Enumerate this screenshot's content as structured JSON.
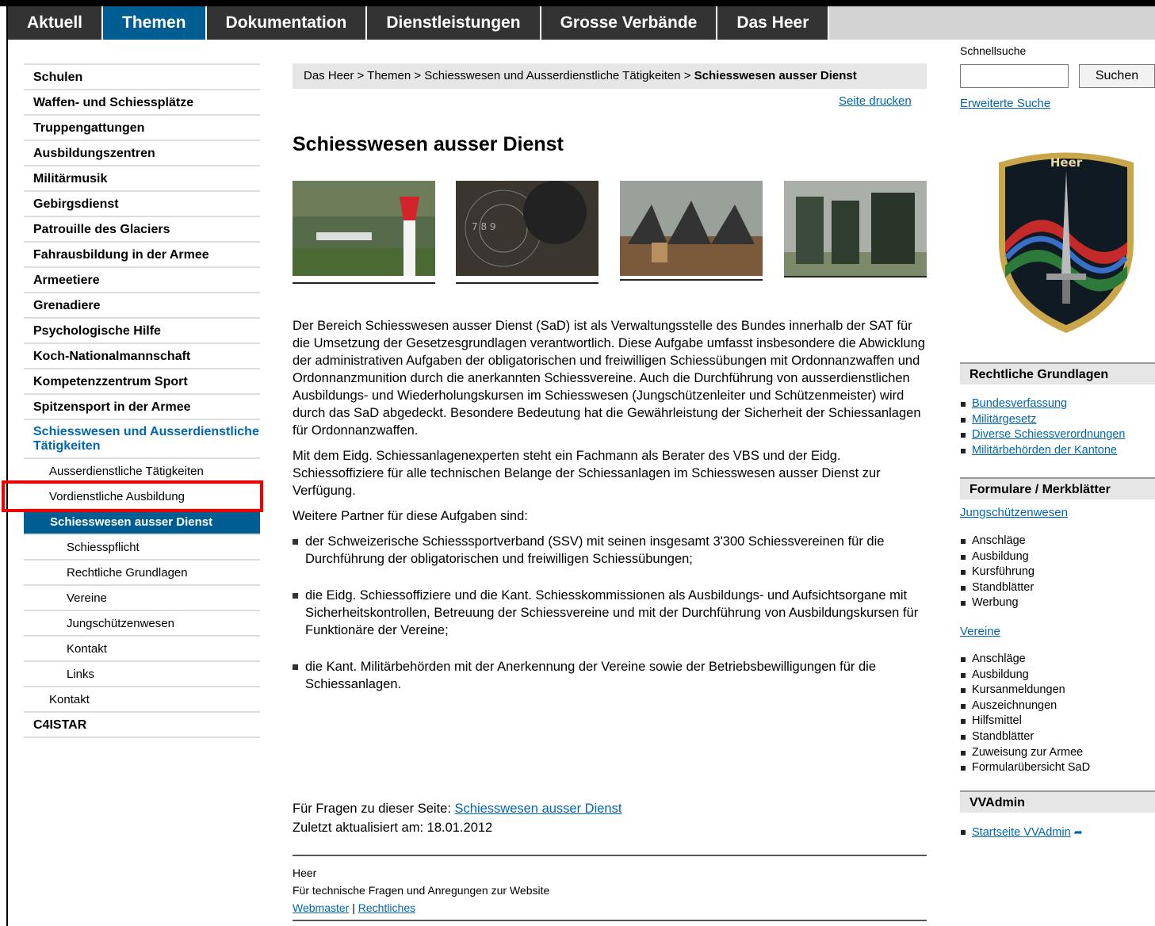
{
  "top_nav": [
    "Aktuell",
    "Themen",
    "Dokumentation",
    "Dienstleistungen",
    "Grosse Verbände",
    "Das Heer"
  ],
  "left_nav": [
    {
      "label": "Schulen",
      "level": 0
    },
    {
      "label": "Waffen- und Schiessplätze",
      "level": 0
    },
    {
      "label": "Truppengattungen",
      "level": 0
    },
    {
      "label": "Ausbildungszentren",
      "level": 0
    },
    {
      "label": "Militärmusik",
      "level": 0
    },
    {
      "label": "Gebirgsdienst",
      "level": 0
    },
    {
      "label": "Patrouille des Glaciers",
      "level": 0
    },
    {
      "label": "Fahrausbildung in der Armee",
      "level": 0
    },
    {
      "label": "Armeetiere",
      "level": 0
    },
    {
      "label": "Grenadiere",
      "level": 0
    },
    {
      "label": "Psychologische Hilfe",
      "level": 0
    },
    {
      "label": "Koch-Nationalmannschaft",
      "level": 0
    },
    {
      "label": "Kompetenzzentrum Sport",
      "level": 0
    },
    {
      "label": "Spitzensport in der Armee",
      "level": 0
    },
    {
      "label": "Schiesswesen und Ausserdienstliche Tätigkeiten",
      "level": 0,
      "active": true
    },
    {
      "label": "Ausserdienstliche Tätigkeiten",
      "level": 1
    },
    {
      "label": "Vordienstliche Ausbildung",
      "level": 1
    },
    {
      "label": "Schiesswesen ausser Dienst",
      "level": 1,
      "selected": true
    },
    {
      "label": "Schiesspflicht",
      "level": 2
    },
    {
      "label": "Rechtliche Grundlagen",
      "level": 2
    },
    {
      "label": "Vereine",
      "level": 2
    },
    {
      "label": "Jungschützenwesen",
      "level": 2
    },
    {
      "label": "Kontakt",
      "level": 2
    },
    {
      "label": "Links",
      "level": 2
    },
    {
      "label": "Kontakt",
      "level": 1
    },
    {
      "label": "C4ISTAR",
      "level": 0
    }
  ],
  "breadcrumb": {
    "path": "Das Heer > Themen > Schiesswesen und Ausserdienstliche Tätigkeiten > ",
    "current": "Schiesswesen ausser Dienst"
  },
  "print_link": "Seite drucken",
  "page_title": "Schiesswesen ausser Dienst",
  "paragraphs": [
    "Der Bereich Schiesswesen ausser Dienst (SaD) ist als Verwaltungsstelle des Bundes innerhalb der SAT für die Umsetzung der Gesetzesgrundlagen verantwortlich. Diese Aufgabe umfasst insbesondere die Abwicklung der administrativen Aufgaben der obligatorischen und freiwilligen Schiessübungen mit Ordonnanzwaffen und Ordonnanzmunition durch die anerkannten Schiessvereine. Auch die Durchführung von ausserdienstlichen Ausbildungs- und Wiederholungskursen im Schiesswesen (Jungschützenleiter und Schützenmeister) wird durch das SaD abgedeckt. Besondere Bedeutung hat die Gewährleistung der Sicherheit der Schiessanlagen für Ordonnanzwaffen.",
    "Mit dem Eidg. Schiessanlagenexperten steht ein Fachmann als Berater des VBS und der Eidg. Schiessoffiziere für alle technischen Belange der Schiessanlagen im Schiesswesen ausser Dienst zur Verfügung.",
    "Weitere Partner für diese Aufgaben sind:"
  ],
  "bullets": [
    "der Schweizerische Schiesssportverband (SSV) mit seinen insgesamt 3'300 Schiessvereinen für die Durchführung der obligatorischen und freiwilligen Schiessübungen;",
    "die Eidg. Schiessoffiziere und die Kant. Schiesskommissionen als Ausbildungs- und Aufsichtsorgane mit Sicherheitskontrollen, Betreuung der Schiessvereine und mit der Durchführung von Ausbildungskursen für Funktionäre der Vereine;",
    "die Kant. Militärbehörden mit der Anerkennung der Vereine sowie der Betriebsbewilligungen für die Schiessanlagen."
  ],
  "contact": {
    "prefix": "Für Fragen zu dieser Seite: ",
    "link": "Schiesswesen ausser Dienst",
    "updated": "Zuletzt aktualisiert am: 18.01.2012"
  },
  "footer": {
    "org": "Heer",
    "note": "Für technische Fragen und Anregungen zur Website",
    "webmaster": "Webmaster",
    "separator": " | ",
    "legal": "Rechtliches"
  },
  "search": {
    "label": "Schnellsuche",
    "button": "Suchen",
    "advanced": "Erweiterte Suche",
    "value": ""
  },
  "badge": {
    "text": "Heer"
  },
  "right": {
    "rechtliche": {
      "title": "Rechtliche Grundlagen",
      "links": [
        "Bundesverfassung",
        "Militärgesetz",
        "Diverse Schiessverordnungen",
        "Militärbehörden der Kantone"
      ]
    },
    "formulare": {
      "title": "Formulare / Merkblätter",
      "jung": {
        "title": "Jungschützenwesen",
        "items": [
          "Anschläge",
          "Ausbildung",
          "Kursführung",
          "Standblätter",
          "Werbung"
        ]
      },
      "vereine": {
        "title": "Vereine",
        "items": [
          "Anschläge",
          "Ausbildung",
          "Kursanmeldungen",
          "Auszeichnungen",
          "Hilfsmittel",
          "Standblätter",
          "Zuweisung zur Armee",
          "Formularübersicht SaD"
        ]
      }
    },
    "vvadmin": {
      "title": "VVAdmin",
      "link": "Startseite VVAdmin"
    }
  }
}
